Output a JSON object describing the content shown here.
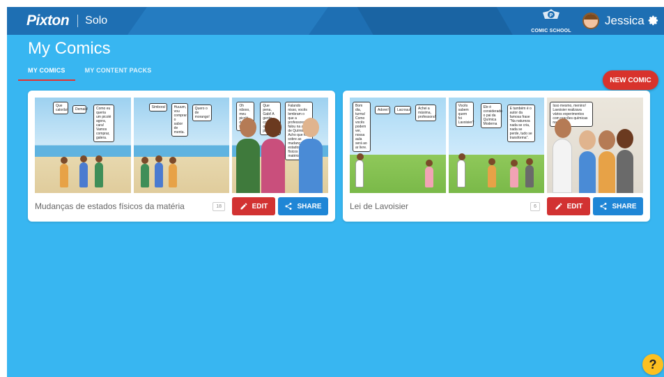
{
  "header": {
    "logo": "Pixton",
    "plan": "Solo",
    "comic_school": "COMIC SCHOOL",
    "user_name": "Jessica"
  },
  "page": {
    "title": "My Comics",
    "tabs": [
      {
        "label": "MY COMICS",
        "active": true
      },
      {
        "label": "MY CONTENT PACKS",
        "active": false
      }
    ],
    "new_comic_label": "NEW COMIC"
  },
  "comics": [
    {
      "title": "Mudanças de estados físicos da matéria",
      "count": "18",
      "edit_label": "EDIT",
      "share_label": "SHARE",
      "panels": [
        {
          "bubbles": [
            "Que calorão!",
            "Demais!",
            "Como eu queria um picolé agora, cara! Vamos comprar, galera."
          ]
        },
        {
          "bubbles": [
            "Simbora!",
            "Huuum, vou comprar o sabor de menta.",
            "Quero o de morango!"
          ]
        },
        {
          "bubbles": [
            "Oh nãooo, meu picolé derreteu todinho.",
            "Que pena, Gabi! A gente compra outro já já.",
            "Falando nisso, vocês lembram o que a professora falou na aula de Química? Acho que foi sobre as mudanças de estados físicos da matéria."
          ]
        }
      ]
    },
    {
      "title": "Lei de Lavoisier",
      "count": "6",
      "edit_label": "EDIT",
      "share_label": "SHARE",
      "panels": [
        {
          "bubbles": [
            "Bom dia, turma! Como vocês podem ver, nossa aula será ao ar livre.",
            "Adorei!",
            "Lacrouu!",
            "Achei a máxima, professora!"
          ]
        },
        {
          "bubbles": [
            "Vocês sabem quem foi Lavoisier?",
            "Ele é considerado o pai da Química Moderna",
            "E também é o autor da famosa frase \"Na natureza nada se cria, nada se perde, tudo se transforma\"."
          ]
        },
        {
          "bubbles": [
            "Isso mesmo, menino! Lavoisier realizava vários experimentos com reações químicas na época."
          ]
        }
      ]
    }
  ],
  "help_label": "?",
  "colors": {
    "background": "#38b6f1",
    "topbar": "#1e6fb3",
    "accent_red": "#d23232",
    "share_blue": "#1f86d6",
    "help_yellow": "#fcc020"
  }
}
